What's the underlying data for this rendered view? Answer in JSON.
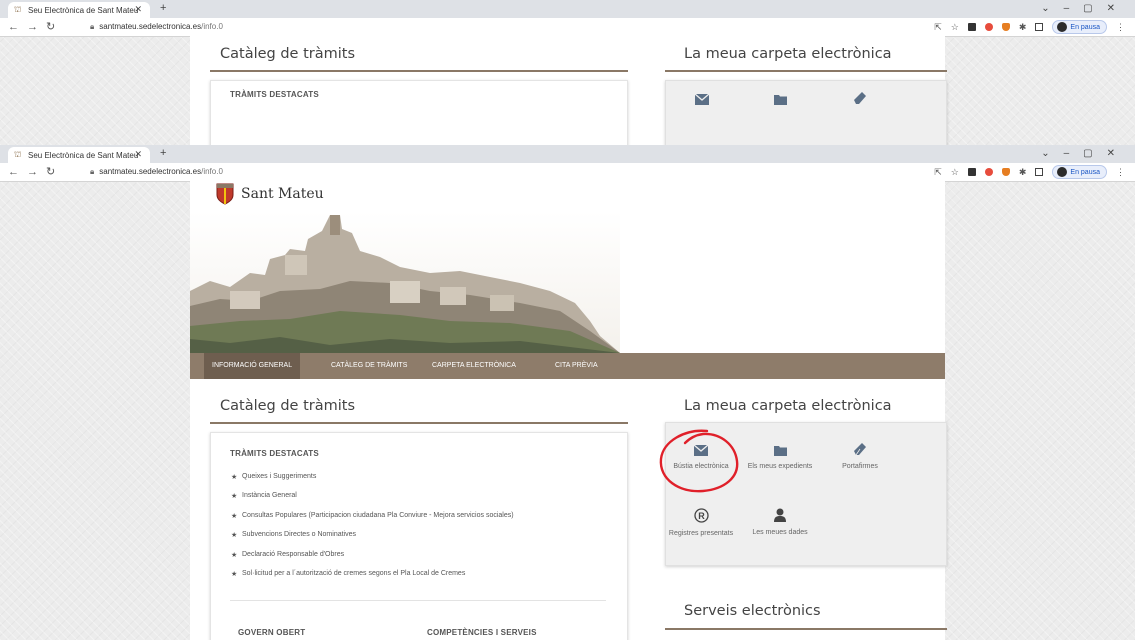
{
  "browser": {
    "tab_title": "Seu Electrònica de Sant Mateu",
    "url_host": "santmateu.sedelectronica.es",
    "url_path": "/info.0",
    "profile_status": "En pausa"
  },
  "site": {
    "town_name": "Sant Mateu",
    "nav": [
      "INFORMACIÓ GENERAL",
      "CATÀLEG DE TRÀMITS",
      "CARPETA ELECTRÒNICA",
      "CITA PRÈVIA"
    ],
    "catalog": {
      "title": "Catàleg de tràmits",
      "subtitle": "TRÀMITS DESTACATS",
      "items": [
        "Queixes i Suggeriments",
        "Instància General",
        "Consultas Populares (Participacion ciudadana Pla Conviure - Mejora servicios sociales)",
        "Subvencions Directes o Nominatives",
        "Declaració Responsable d'Obres",
        "Sol·licitud per a l´autorització de cremes segons el Pla Local de Cremes"
      ],
      "govern_obert": "GOVERN OBERT",
      "competencies": "COMPETÈNCIES I SERVEIS"
    },
    "carpeta": {
      "title": "La meua carpeta electrònica",
      "items": [
        {
          "label": "Bústia electrònica",
          "icon": "envelope-icon"
        },
        {
          "label": "Els meus expedients",
          "icon": "folder-icon"
        },
        {
          "label": "Portafirmes",
          "icon": "sign-pen-icon"
        },
        {
          "label": "Registres presentats",
          "icon": "registered-icon"
        },
        {
          "label": "Les meues dades",
          "icon": "user-icon"
        }
      ]
    },
    "serveis": {
      "title": "Serveis electrònics"
    }
  },
  "colors": {
    "nav_bar": "#8e7c6a",
    "nav_active": "#6e5e4f",
    "accent_rule": "#8a7866",
    "annotation": "#e0202a"
  }
}
